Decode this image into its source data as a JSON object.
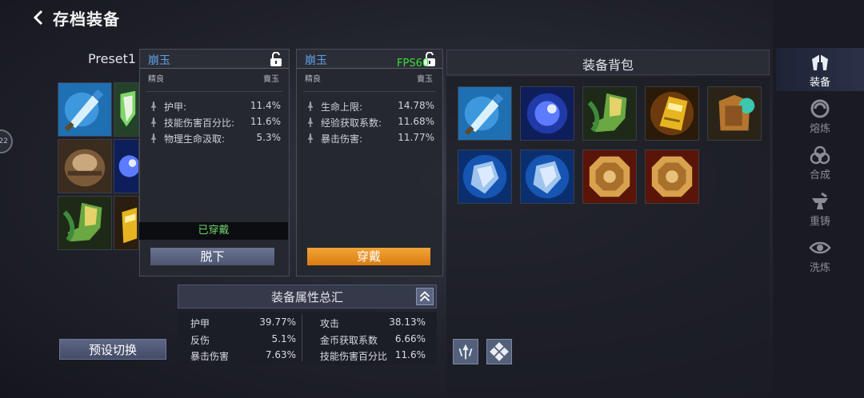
{
  "header": {
    "title": "存档装备",
    "back_icon": "chevron-left-icon"
  },
  "side_nav": [
    {
      "label": "装备",
      "icon": "helmet-icon",
      "active": true
    },
    {
      "label": "熔炼",
      "icon": "swirl-icon",
      "active": false
    },
    {
      "label": "合成",
      "icon": "triquetra-icon",
      "active": false
    },
    {
      "label": "重铸",
      "icon": "anvil-icon",
      "active": false
    },
    {
      "label": "洗炼",
      "icon": "eye-icon",
      "active": false
    }
  ],
  "edge_bubble": "22",
  "preset": {
    "label": "Preset1",
    "slots": [
      {
        "item": "sword"
      },
      {
        "item": "shield"
      },
      {
        "item": "armor"
      },
      {
        "item": "orb"
      },
      {
        "item": "boots"
      },
      {
        "item": "gauntlet"
      }
    ],
    "switch_label": "预设切换"
  },
  "card_equipped": {
    "name": "崩玉",
    "quality": "精良",
    "type": "賣玉",
    "lock_icon": "lock-open-icon",
    "stats": [
      {
        "name": "护甲:",
        "value": "11.4%"
      },
      {
        "name": "技能伤害百分比:",
        "value": "11.6%"
      },
      {
        "name": "物理生命汲取:",
        "value": "5.3%"
      }
    ],
    "status": "已穿戴",
    "action": "脱下"
  },
  "card_compare": {
    "name": "崩玉",
    "quality": "精良",
    "type": "賣玉",
    "lock_icon": "lock-open-icon",
    "stats": [
      {
        "name": "生命上限:",
        "value": "14.78%"
      },
      {
        "name": "经验获取系数:",
        "value": "11.68%"
      },
      {
        "name": "暴击伤害:",
        "value": "11.77%"
      }
    ],
    "action": "穿戴"
  },
  "fps_label": "FPS60",
  "summary": {
    "title": "装备属性总汇",
    "left": [
      {
        "k": "护甲",
        "v": "39.77%"
      },
      {
        "k": "反伤",
        "v": "5.1%"
      },
      {
        "k": "暴击伤害",
        "v": "7.63%"
      }
    ],
    "right": [
      {
        "k": "攻击",
        "v": "38.13%"
      },
      {
        "k": "金币获取系数",
        "v": "6.66%"
      },
      {
        "k": "技能伤害百分比",
        "v": "11.6%"
      }
    ]
  },
  "bag": {
    "title": "装备背包",
    "items": [
      {
        "item": "sword"
      },
      {
        "item": "orb"
      },
      {
        "item": "boots"
      },
      {
        "item": "gauntlet"
      },
      {
        "item": "chest-armor"
      },
      {
        "item": "gem"
      },
      {
        "item": "gem"
      },
      {
        "item": "amulet"
      },
      {
        "item": "amulet"
      }
    ]
  },
  "tools": [
    {
      "icon": "sort-icon"
    },
    {
      "icon": "grid-icon"
    }
  ],
  "colors": {
    "accent_orange": "#e58d1c",
    "name_blue": "#5fa0e8",
    "equipped_green": "#6fd36b",
    "fps_green": "#38e038"
  }
}
